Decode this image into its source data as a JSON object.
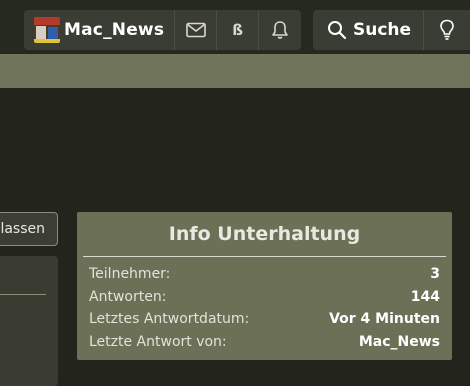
{
  "nav": {
    "username": "Mac_News",
    "beta_label": "ß",
    "icons": [
      "envelope-icon",
      "beta-icon",
      "bell-icon"
    ]
  },
  "search": {
    "label": "Suche",
    "icon": "search-icon",
    "extra_icon": "lightbulb-icon"
  },
  "left": {
    "button_label": "lassen"
  },
  "info": {
    "title": "Info Unterhaltung",
    "rows": [
      {
        "key": "Teilnehmer:",
        "value": "3"
      },
      {
        "key": "Antworten:",
        "value": "144"
      },
      {
        "key": "Letztes Antwortdatum:",
        "value": "Vor 4 Minuten"
      },
      {
        "key": "Letzte Antwort von:",
        "value": "Mac_News"
      }
    ]
  },
  "colors": {
    "background": "#23251d",
    "accent": "#6f745a",
    "card": "#6b7056"
  }
}
